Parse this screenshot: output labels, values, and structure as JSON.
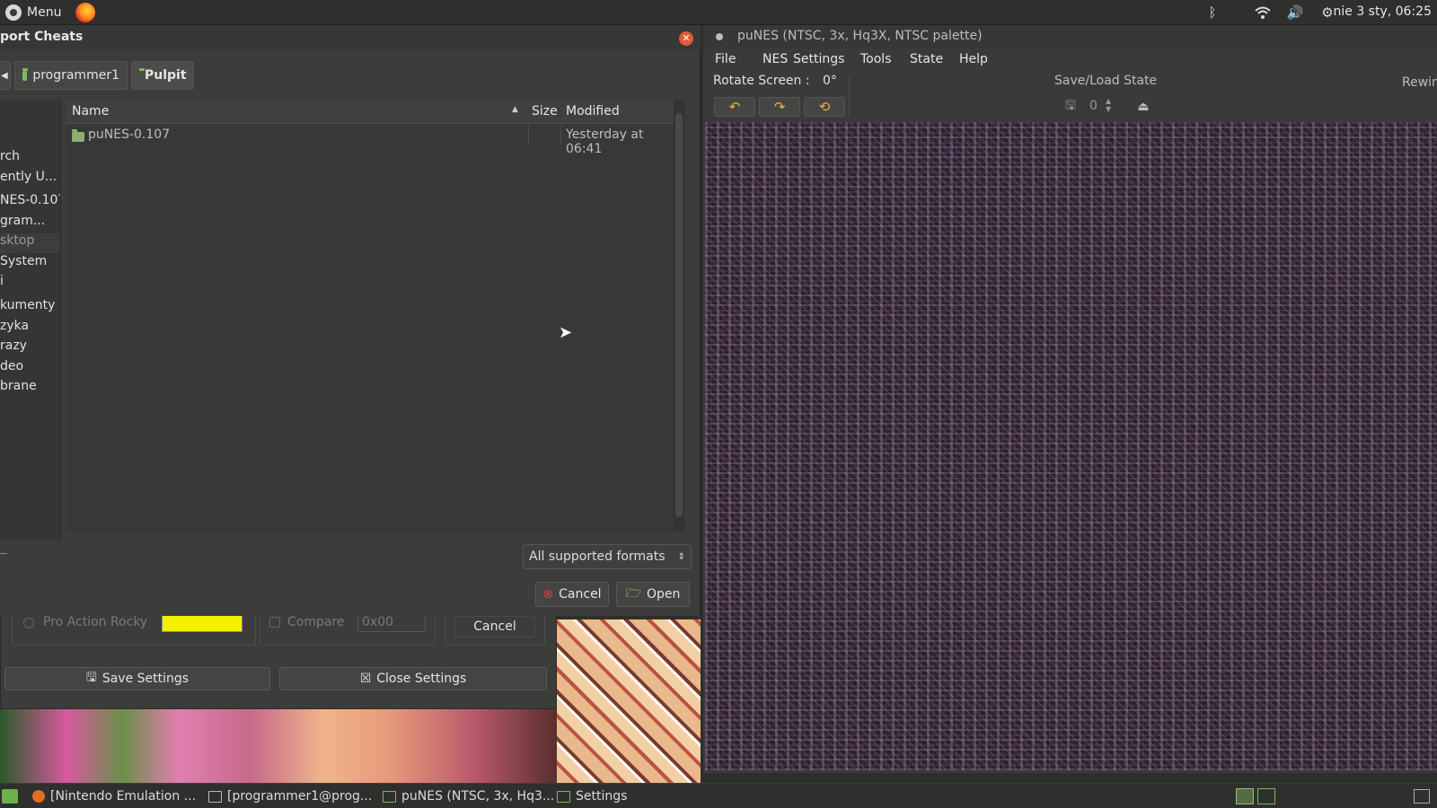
{
  "top_panel": {
    "menu_label": "Menu",
    "clock": "nie 3 sty, 06:25",
    "tray_icons": [
      "bluetooth-icon",
      "wifi-icon",
      "volume-icon",
      "settings-icon"
    ]
  },
  "dialog": {
    "title": "port Cheats",
    "breadcrumbs": [
      "programmer1",
      "Pulpit"
    ],
    "places": [
      "rch",
      "ently U...",
      "NES-0.107",
      "gram...",
      "sktop",
      " System",
      "i",
      "kumenty",
      "zyka",
      "razy",
      "deo",
      "brane"
    ],
    "columns": {
      "name": "Name",
      "size": "Size",
      "modified": "Modified"
    },
    "files": [
      {
        "name": "puNES-0.107",
        "size": "",
        "modified": "Yesterday at 06:41"
      }
    ],
    "filter": "All supported formats",
    "cancel_label": "Cancel",
    "open_label": "Open"
  },
  "settings": {
    "pro_action_label": "Pro Action Rocky",
    "compare_label": "Compare",
    "compare_value": "0x00",
    "cancel_label": "Cancel",
    "save_label": "Save Settings",
    "close_label": "Close Settings",
    "color_swatch": "#f2ef00"
  },
  "punes": {
    "title": "puNES (NTSC, 3x, Hq3X, NTSC palette)",
    "menu": [
      "File",
      "NES",
      "Settings",
      "Tools",
      "State",
      "Help"
    ],
    "rotate_label": "Rotate Screen :",
    "rotate_value": "0°",
    "save_load_label": "Save/Load State",
    "slot_value": "0",
    "rewind_label": "Rewin"
  },
  "taskbar": {
    "items": [
      "[Nintendo Emulation ...",
      "[programmer1@prog...",
      "puNES (NTSC, 3x, Hq3...",
      "Settings"
    ]
  }
}
